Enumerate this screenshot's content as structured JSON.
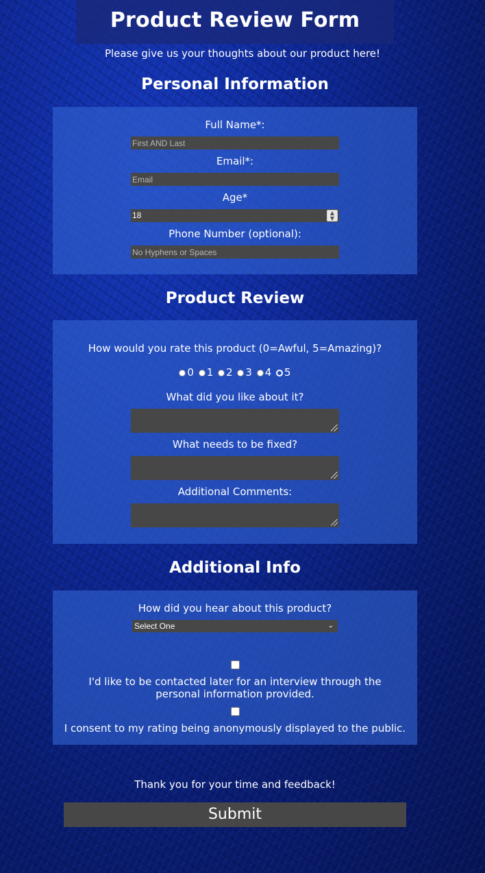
{
  "header": {
    "title": "Product Review Form",
    "subtitle": "Please give us your thoughts about our product here!"
  },
  "personal": {
    "heading": "Personal Information",
    "full_name_label": "Full Name*:",
    "full_name_placeholder": "First AND Last",
    "email_label": "Email*:",
    "email_placeholder": "Email",
    "age_label": "Age*",
    "age_value": "18",
    "phone_label": "Phone Number (optional):",
    "phone_placeholder": "No Hyphens or Spaces"
  },
  "review": {
    "heading": "Product Review",
    "rating_question": "How would you rate this product (0=Awful, 5=Amazing)?",
    "rating_options": [
      "0",
      "1",
      "2",
      "3",
      "4",
      "5"
    ],
    "selected_rating": "5",
    "like_label": "What did you like about it?",
    "fix_label": "What needs to be fixed?",
    "comments_label": "Additional Comments:"
  },
  "additional": {
    "heading": "Additional Info",
    "source_question": "How did you hear about this product?",
    "source_selected": "Select One",
    "contact_consent": "I'd like to be contacted later for an interview through the personal information provided.",
    "display_consent": "I consent to my rating being anonymously displayed to the public."
  },
  "footer": {
    "thanks": "Thank you for your time and feedback!",
    "submit_label": "Submit"
  }
}
